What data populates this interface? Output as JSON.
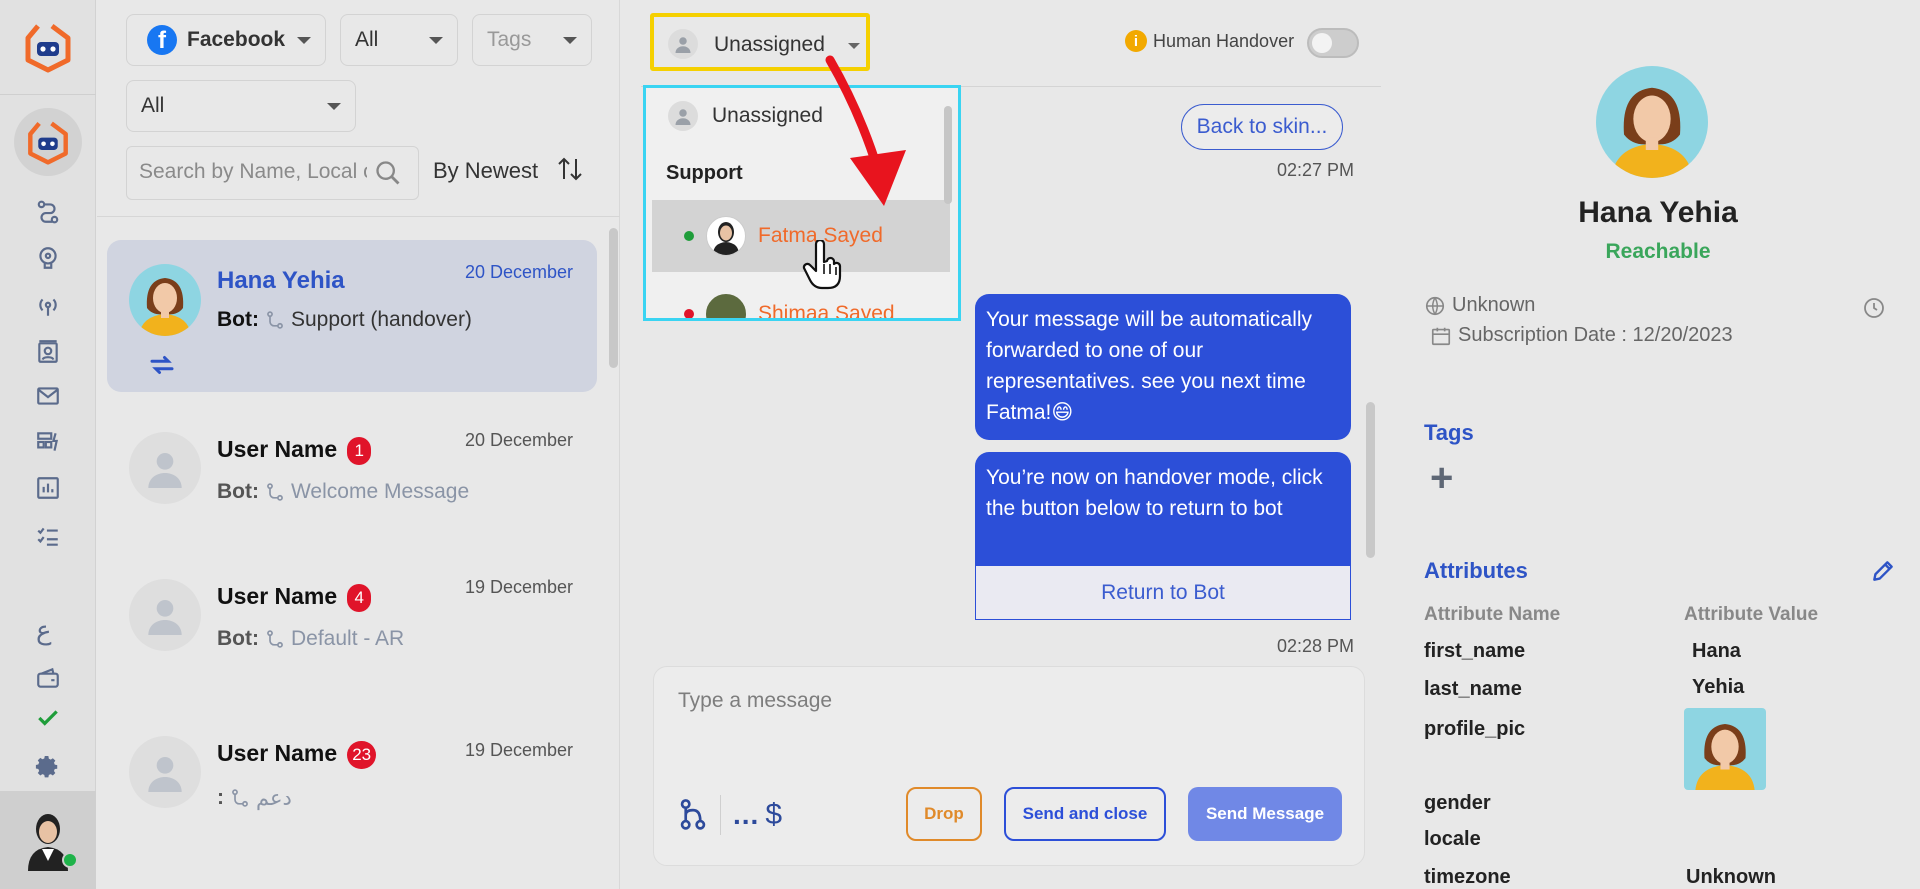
{
  "filters": {
    "channel": "Facebook",
    "status": "All",
    "tags_placeholder": "Tags",
    "secondary": "All",
    "search_placeholder": "Search by Name, Local or Phone",
    "sort_label": "By Newest"
  },
  "conversations": [
    {
      "name": "Hana Yehia",
      "date": "20 December",
      "bot_label": "Bot:",
      "flow": "Support (handover)",
      "badge": ""
    },
    {
      "name": "User Name",
      "date": "20 December",
      "bot_label": "Bot:",
      "flow": "Welcome Message",
      "badge": "1"
    },
    {
      "name": "User Name",
      "date": "19 December",
      "bot_label": "Bot:",
      "flow": "Default - AR",
      "badge": "4"
    },
    {
      "name": "User Name",
      "date": "19 December",
      "bot_label": ":",
      "flow": "دعم",
      "badge": "23"
    }
  ],
  "rail": {
    "language_glyph": "ع"
  },
  "chat": {
    "assignee": "Unassigned",
    "handover_label": "Human Handover",
    "chip_label": "Back to skin...",
    "time_1": "02:27 PM",
    "time_2": "02:28 PM",
    "bubble_1": "Your message will be automatically forwarded to one of our representatives. see you next time Fatma!😄",
    "bubble_2": "You’re now on handover mode, click the button below to return to bot",
    "return_to_bot": "Return to Bot",
    "composer_placeholder": "Type a message",
    "drop_label": "Drop",
    "send_close_label": "Send and close",
    "send_label": "Send Message",
    "dots": "...",
    "dollar": "$"
  },
  "dropdown": {
    "unassigned": "Unassigned",
    "group": "Support",
    "options": [
      {
        "name": "Fatma Sayed",
        "status_color": "#1f9d3a"
      },
      {
        "name": "Shimaa Sayed",
        "status_color": "#e0142a"
      }
    ]
  },
  "profile": {
    "name": "Hana Yehia",
    "status": "Reachable",
    "locale": "Unknown",
    "subscription": "Subscription Date : 12/20/2023",
    "tags_title": "Tags",
    "attributes_title": "Attributes",
    "attr_name_header": "Attribute Name",
    "attr_value_header": "Attribute Value",
    "attributes": [
      {
        "key": "first_name",
        "value": "Hana"
      },
      {
        "key": "last_name",
        "value": "Yehia"
      },
      {
        "key": "profile_pic",
        "value": ""
      },
      {
        "key": "gender",
        "value": ""
      },
      {
        "key": "locale",
        "value": ""
      },
      {
        "key": "timezone",
        "value": "Unknown"
      }
    ]
  },
  "colors": {
    "accent": "#2c4fd8",
    "brand_orange": "#f06a2a",
    "badge_red": "#e0142a",
    "highlight_yellow": "#f5d000",
    "highlight_cyan": "#3ad4f2"
  }
}
